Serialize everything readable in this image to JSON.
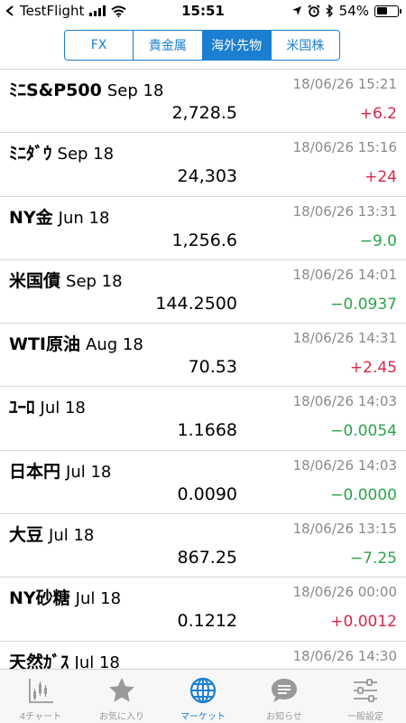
{
  "status_bar": {
    "carrier": "TestFlight",
    "time": "15:51",
    "battery_percent": "54%",
    "battery_level": 0.54
  },
  "segments": [
    {
      "label": "FX",
      "active": false
    },
    {
      "label": "貴金属",
      "active": false
    },
    {
      "label": "海外先物",
      "active": true
    },
    {
      "label": "米国株",
      "active": false
    }
  ],
  "rows": [
    {
      "name": "ﾐﾆS&P500",
      "contract": "Sep 18",
      "time": "18/06/26 15:21",
      "price": "2,728.5",
      "change": "+6.2",
      "direction": "up"
    },
    {
      "name": "ﾐﾆﾀﾞｳ",
      "contract": "Sep 18",
      "time": "18/06/26 15:16",
      "price": "24,303",
      "change": "+24",
      "direction": "up"
    },
    {
      "name": "NY金",
      "contract": "Jun 18",
      "time": "18/06/26 13:31",
      "price": "1,256.6",
      "change": "−9.0",
      "direction": "down"
    },
    {
      "name": "米国債",
      "contract": "Sep 18",
      "time": "18/06/26 14:01",
      "price": "144.2500",
      "change": "−0.0937",
      "direction": "down"
    },
    {
      "name": "WTI原油",
      "contract": "Aug 18",
      "time": "18/06/26 14:31",
      "price": "70.53",
      "change": "+2.45",
      "direction": "up"
    },
    {
      "name": "ﾕｰﾛ",
      "contract": "Jul 18",
      "time": "18/06/26 14:03",
      "price": "1.1668",
      "change": "−0.0054",
      "direction": "down"
    },
    {
      "name": "日本円",
      "contract": "Jul 18",
      "time": "18/06/26 14:03",
      "price": "0.0090",
      "change": "−0.0000",
      "direction": "down"
    },
    {
      "name": "大豆",
      "contract": "Jul 18",
      "time": "18/06/26 13:15",
      "price": "867.25",
      "change": "−7.25",
      "direction": "down"
    },
    {
      "name": "NY砂糖",
      "contract": "Jul 18",
      "time": "18/06/26 00:00",
      "price": "0.1212",
      "change": "+0.0012",
      "direction": "up"
    },
    {
      "name": "天然ｶﾞｽ",
      "contract": "Jul 18",
      "time": "18/06/26 14:30",
      "price": "",
      "change": "",
      "direction": "up"
    }
  ],
  "tabs": [
    {
      "label": "4チャート",
      "icon": "chart-icon",
      "active": false
    },
    {
      "label": "お気に入り",
      "icon": "star-icon",
      "active": false
    },
    {
      "label": "マーケット",
      "icon": "globe-icon",
      "active": true
    },
    {
      "label": "お知らせ",
      "icon": "speech-bubble-icon",
      "active": false
    },
    {
      "label": "一般設定",
      "icon": "sliders-icon",
      "active": false
    }
  ],
  "colors": {
    "accent": "#1a7fd0",
    "up": "#d8264a",
    "down": "#2aa44a",
    "time_gray": "#8a8a8a",
    "tab_inactive": "#999999"
  }
}
